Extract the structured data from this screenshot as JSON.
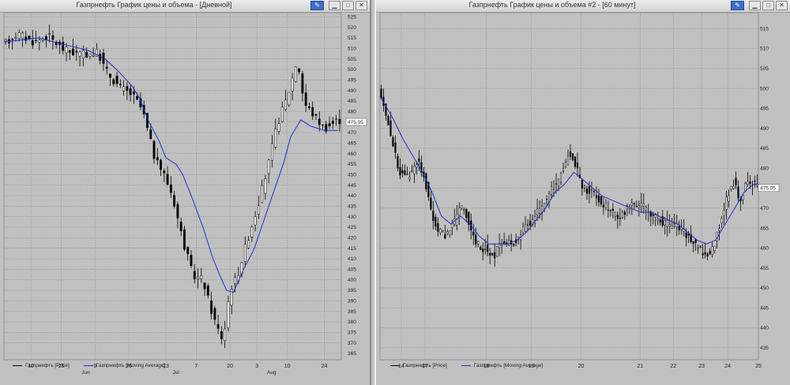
{
  "colors": {
    "price": "#000000",
    "ma": "#1e2ed0",
    "bg": "#c0c0c0"
  },
  "window1": {
    "title": "Газпрнефть График цены и объема - [Дневной]",
    "buttons": {
      "pin": "pin-icon",
      "minimize": "minimize-icon",
      "restore": "restore-icon",
      "close": "close-icon"
    },
    "legend": {
      "price": "Газпрнефть [Price]",
      "ma": "Газпрнефть [Moving Average]"
    }
  },
  "window2": {
    "title": "Газпрнефть График цены и объема #2 - [60 минут]",
    "buttons": {
      "pin": "pin-icon",
      "minimize": "minimize-icon",
      "restore": "restore-icon",
      "close": "close-icon"
    },
    "legend": {
      "price": "Газпрнефть [Price]",
      "ma": "Газпрнефть [Moving Average]"
    }
  },
  "chart_data": [
    {
      "type": "candlestick",
      "window": "window1",
      "ylim": [
        362,
        527
      ],
      "yticks": [
        365,
        370,
        375,
        380,
        385,
        390,
        395,
        400,
        405,
        410,
        415,
        420,
        425,
        430,
        435,
        440,
        445,
        450,
        455,
        460,
        465,
        470,
        475,
        480,
        485,
        490,
        495,
        500,
        505,
        510,
        515,
        520,
        525
      ],
      "last_label": "475.05",
      "last_value": 475.05,
      "n": 100,
      "x_labels": [
        {
          "i": 8,
          "text": "10"
        },
        {
          "i": 17,
          "text": "25"
        },
        {
          "i": 27,
          "text": "9"
        },
        {
          "i": 37,
          "text": "26"
        },
        {
          "i": 48,
          "text": "23"
        },
        {
          "i": 57,
          "text": "7"
        },
        {
          "i": 67,
          "text": "20"
        },
        {
          "i": 75,
          "text": "3"
        },
        {
          "i": 84,
          "text": "10"
        },
        {
          "i": 95,
          "text": "24"
        }
      ],
      "month_labels": [
        {
          "i": 23,
          "text": "Jun"
        },
        {
          "i": 50,
          "text": "Jul"
        },
        {
          "i": 78,
          "text": "Aug"
        }
      ],
      "close_path": [
        [
          0,
          512
        ],
        [
          4,
          517
        ],
        [
          9,
          513
        ],
        [
          13,
          516
        ],
        [
          18,
          509
        ],
        [
          23,
          507
        ],
        [
          28,
          508
        ],
        [
          30,
          500
        ],
        [
          34,
          492
        ],
        [
          38,
          488
        ],
        [
          41,
          481
        ],
        [
          45,
          456
        ],
        [
          47,
          452
        ],
        [
          50,
          440
        ],
        [
          53,
          419
        ],
        [
          56,
          402
        ],
        [
          59,
          400
        ],
        [
          61,
          388
        ],
        [
          63,
          378
        ],
        [
          65,
          371
        ],
        [
          67,
          396
        ],
        [
          69,
          401
        ],
        [
          72,
          418
        ],
        [
          75,
          434
        ],
        [
          78,
          452
        ],
        [
          81,
          474
        ],
        [
          84,
          487
        ],
        [
          87,
          505
        ],
        [
          89,
          484
        ],
        [
          92,
          478
        ],
        [
          95,
          472
        ],
        [
          99,
          476
        ]
      ],
      "ma_path": [
        [
          0,
          513
        ],
        [
          5,
          514
        ],
        [
          10,
          515
        ],
        [
          15,
          513
        ],
        [
          20,
          511
        ],
        [
          25,
          509
        ],
        [
          30,
          505
        ],
        [
          34,
          499
        ],
        [
          38,
          492
        ],
        [
          40,
          487
        ],
        [
          43,
          475
        ],
        [
          46,
          466
        ],
        [
          48,
          458
        ],
        [
          51,
          455
        ],
        [
          53,
          450
        ],
        [
          56,
          438
        ],
        [
          59,
          425
        ],
        [
          62,
          410
        ],
        [
          64,
          402
        ],
        [
          66,
          395
        ],
        [
          68,
          394
        ],
        [
          71,
          405
        ],
        [
          74,
          414
        ],
        [
          77,
          428
        ],
        [
          80,
          442
        ],
        [
          83,
          456
        ],
        [
          85,
          468
        ],
        [
          88,
          476
        ],
        [
          91,
          473
        ],
        [
          95,
          471
        ],
        [
          99,
          471
        ]
      ]
    },
    {
      "type": "candlestick",
      "window": "window2",
      "ylim": [
        432,
        519
      ],
      "yticks": [
        435,
        440,
        445,
        450,
        455,
        460,
        465,
        470,
        475,
        480,
        485,
        490,
        495,
        500,
        505,
        510,
        515
      ],
      "last_label": "475.05",
      "last_value": 475.05,
      "n": 160,
      "x_labels": [
        {
          "i": 9,
          "text": "14"
        },
        {
          "i": 19,
          "text": "17"
        },
        {
          "i": 45,
          "text": "18"
        },
        {
          "i": 64,
          "text": "19"
        },
        {
          "i": 85,
          "text": "20"
        },
        {
          "i": 110,
          "text": "21"
        },
        {
          "i": 124,
          "text": "22"
        },
        {
          "i": 136,
          "text": "23"
        },
        {
          "i": 147,
          "text": "24"
        },
        {
          "i": 160,
          "text": "25"
        }
      ],
      "month_labels": [],
      "close_path": [
        [
          0,
          499
        ],
        [
          4,
          490
        ],
        [
          8,
          479
        ],
        [
          12,
          478
        ],
        [
          16,
          482
        ],
        [
          19,
          477
        ],
        [
          22,
          468
        ],
        [
          24,
          465
        ],
        [
          27,
          463
        ],
        [
          31,
          466
        ],
        [
          35,
          471
        ],
        [
          38,
          465
        ],
        [
          42,
          460
        ],
        [
          45,
          460
        ],
        [
          48,
          458
        ],
        [
          52,
          462
        ],
        [
          56,
          461
        ],
        [
          60,
          464
        ],
        [
          64,
          467
        ],
        [
          68,
          470
        ],
        [
          72,
          474
        ],
        [
          76,
          478
        ],
        [
          80,
          484
        ],
        [
          83,
          480
        ],
        [
          86,
          475
        ],
        [
          90,
          474
        ],
        [
          94,
          471
        ],
        [
          98,
          469
        ],
        [
          102,
          468
        ],
        [
          106,
          471
        ],
        [
          110,
          471
        ],
        [
          114,
          469
        ],
        [
          118,
          467
        ],
        [
          122,
          466
        ],
        [
          126,
          465
        ],
        [
          130,
          463
        ],
        [
          134,
          460
        ],
        [
          138,
          458
        ],
        [
          141,
          460
        ],
        [
          144,
          467
        ],
        [
          148,
          475
        ],
        [
          150,
          477
        ],
        [
          152,
          472
        ],
        [
          155,
          476
        ],
        [
          158,
          476
        ],
        [
          160,
          476
        ]
      ],
      "ma_path": [
        [
          0,
          498
        ],
        [
          5,
          493
        ],
        [
          10,
          487
        ],
        [
          14,
          483
        ],
        [
          18,
          479
        ],
        [
          22,
          474
        ],
        [
          26,
          468
        ],
        [
          30,
          466
        ],
        [
          34,
          468
        ],
        [
          38,
          466
        ],
        [
          42,
          463
        ],
        [
          46,
          461
        ],
        [
          50,
          461
        ],
        [
          54,
          461
        ],
        [
          58,
          462
        ],
        [
          62,
          464
        ],
        [
          66,
          467
        ],
        [
          70,
          470
        ],
        [
          74,
          474
        ],
        [
          78,
          476
        ],
        [
          82,
          479
        ],
        [
          86,
          477
        ],
        [
          90,
          475
        ],
        [
          94,
          473
        ],
        [
          98,
          472
        ],
        [
          102,
          471
        ],
        [
          106,
          470
        ],
        [
          110,
          469
        ],
        [
          114,
          469
        ],
        [
          118,
          468
        ],
        [
          122,
          467
        ],
        [
          126,
          466
        ],
        [
          130,
          464
        ],
        [
          134,
          462
        ],
        [
          138,
          461
        ],
        [
          142,
          462
        ],
        [
          146,
          466
        ],
        [
          150,
          470
        ],
        [
          154,
          474
        ],
        [
          158,
          476
        ],
        [
          160,
          476
        ]
      ]
    }
  ]
}
